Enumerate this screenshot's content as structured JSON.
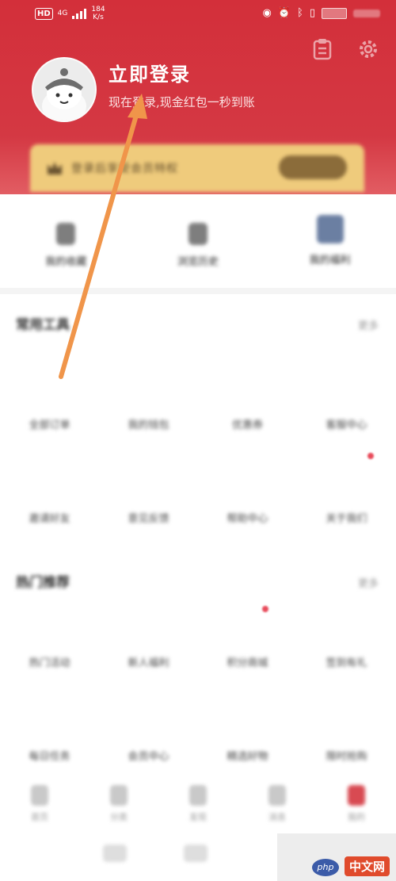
{
  "status_bar": {
    "hd": "HD",
    "network": "4G",
    "speed": "184",
    "speed_unit": "K/s"
  },
  "profile": {
    "login_title": "立即登录",
    "login_subtitle": "现在登录,现金红包一秒到账"
  },
  "vip_banner": {
    "text": "登录后享受会员特权"
  },
  "quick_actions": [
    {
      "label": "我的收藏"
    },
    {
      "label": "浏览历史"
    },
    {
      "label": "我的福利"
    }
  ],
  "section_tools": {
    "title": "常用工具",
    "more": "更多",
    "items": [
      "全部订单",
      "我的钱包",
      "优惠券",
      "客服中心",
      "邀请好友",
      "意见反馈",
      "帮助中心",
      "关于我们"
    ]
  },
  "section_recommend": {
    "title": "热门推荐",
    "more": "更多",
    "items": [
      "热门活动",
      "新人福利",
      "积分商城",
      "签到有礼",
      "每日任务",
      "会员中心",
      "精选好物",
      "限时抢购"
    ]
  },
  "tabbar": [
    {
      "label": "首页"
    },
    {
      "label": "分类"
    },
    {
      "label": "发现"
    },
    {
      "label": "消息"
    },
    {
      "label": "我的"
    }
  ],
  "watermark": {
    "php": "php",
    "text": "中文网"
  },
  "colors": {
    "header_red": "#d32f3a",
    "vip_gold": "#efcb7c",
    "arrow_orange": "#f0954a"
  }
}
